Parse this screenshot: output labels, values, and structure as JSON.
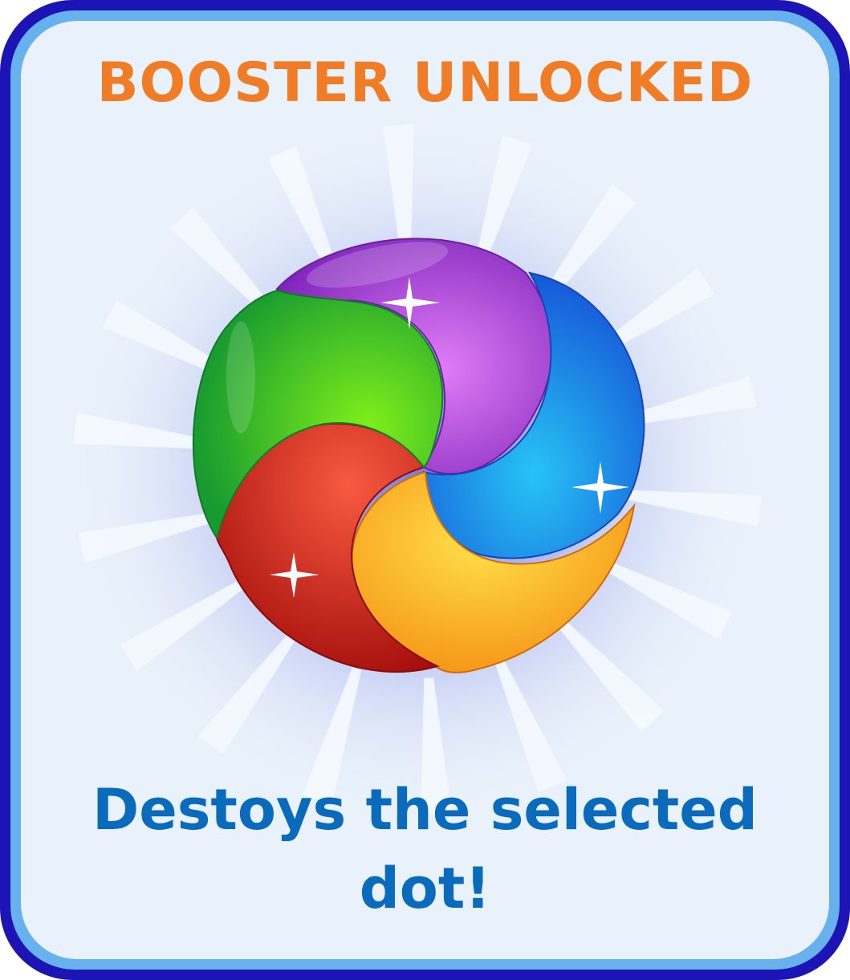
{
  "dialog": {
    "title": "BOOSTER UNLOCKED",
    "description": "Destoys the selected dot!"
  },
  "booster": {
    "icon": "swirl-orb-icon",
    "segment_colors": [
      "#a23ad6",
      "#1e90f0",
      "#f7a51a",
      "#d8261e",
      "#3bc22a"
    ]
  },
  "colors": {
    "title": "#f07c25",
    "description": "#0a6bbd",
    "frame_outer": "#1c14b4",
    "frame_inner": "#66b1ee",
    "panel": "#e9f1fa"
  }
}
